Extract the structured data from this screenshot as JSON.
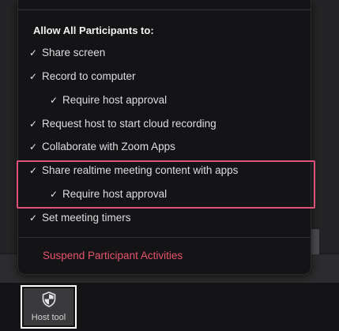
{
  "menu": {
    "heading": "Allow All Participants to:",
    "items": [
      {
        "label": "Share screen",
        "checked": true,
        "level": 1
      },
      {
        "label": "Record to computer",
        "checked": true,
        "level": 1
      },
      {
        "label": "Require host approval",
        "checked": true,
        "level": 2
      },
      {
        "label": "Request host to start cloud recording",
        "checked": true,
        "level": 1
      },
      {
        "label": "Collaborate with Zoom Apps",
        "checked": true,
        "level": 1
      },
      {
        "label": "Share realtime meeting content with apps",
        "checked": true,
        "level": 1
      },
      {
        "label": "Require host approval",
        "checked": true,
        "level": 2
      },
      {
        "label": "Set meeting timers",
        "checked": true,
        "level": 1
      }
    ],
    "suspend_label": "Suspend Participant Activities",
    "check_glyph": "✓"
  },
  "toolbar": {
    "host_tool_label": "Host tool",
    "host_tool_icon": "shield-icon"
  },
  "colors": {
    "menu_bg": "#141416",
    "danger_text": "#e8536d",
    "highlight_border": "#e0517a",
    "focus_border": "#ffffff"
  }
}
